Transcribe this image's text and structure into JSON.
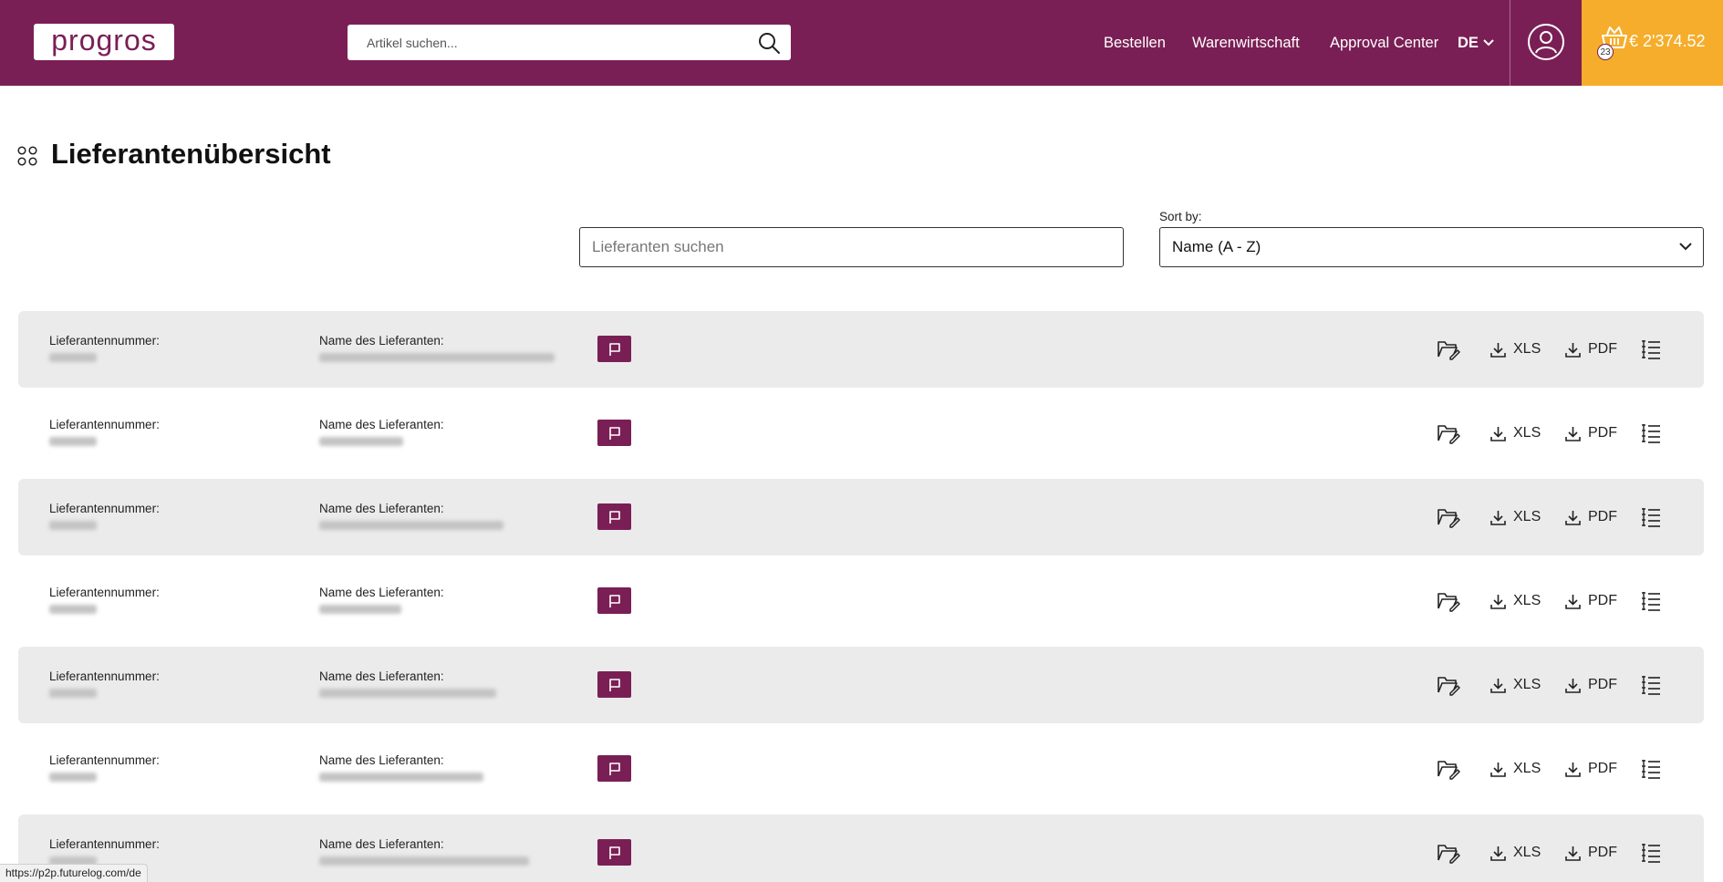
{
  "header": {
    "logo_text": "progros",
    "search": {
      "placeholder": "Artikel suchen...",
      "value": ""
    },
    "nav": [
      "Bestellen",
      "Warenwirtschaft",
      "Approval Center"
    ],
    "language": "DE",
    "cart": {
      "count": "23",
      "amount": "€ 2'374.52"
    }
  },
  "colors": {
    "brand": "#7a1f55",
    "accent": "#f6ad2b",
    "row_shade": "#ebebeb"
  },
  "page": {
    "title": "Lieferantenübersicht",
    "supplier_search": {
      "placeholder": "Lieferanten suchen",
      "value": ""
    },
    "sort": {
      "label": "Sort by:",
      "value": "Name (A - Z)"
    }
  },
  "suppliers": {
    "labels": {
      "number": "Lieferantennummer:",
      "name": "Name des Lieferanten:"
    },
    "actions": {
      "xls": "XLS",
      "pdf": "PDF"
    },
    "rows": [
      {
        "number": "",
        "name": ""
      },
      {
        "number": "",
        "name": ""
      },
      {
        "number": "",
        "name": ""
      },
      {
        "number": "",
        "name": ""
      },
      {
        "number": "",
        "name": ""
      },
      {
        "number": "",
        "name": ""
      },
      {
        "number": "",
        "name": ""
      }
    ]
  },
  "statusbar": {
    "url": "https://p2p.futurelog.com/de"
  }
}
